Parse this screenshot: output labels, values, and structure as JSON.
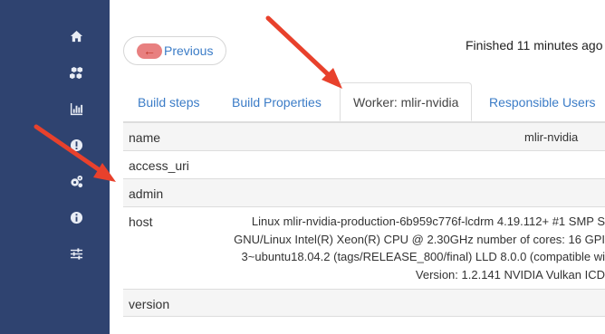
{
  "sidebar": {
    "icons": [
      "home-icon",
      "cubes-icon",
      "bar-chart-icon",
      "exclamation-icon",
      "cogs-icon",
      "info-icon",
      "sliders-icon"
    ]
  },
  "header": {
    "previous_label": "Previous",
    "finished_text": "Finished 11 minutes ago"
  },
  "tabs": [
    {
      "label": "Build steps"
    },
    {
      "label": "Build Properties"
    },
    {
      "label": "Worker: mlir-nvidia"
    },
    {
      "label": "Responsible Users"
    }
  ],
  "table": {
    "rows": [
      {
        "key": "name",
        "value": "mlir-nvidia"
      },
      {
        "key": "access_uri",
        "value": ""
      },
      {
        "key": "admin",
        "value": ""
      },
      {
        "key": "host",
        "lines": [
          "Linux mlir-nvidia-production-6b959c776f-lcdrm 4.19.112+ #1 SMP S",
          "GNU/Linux Intel(R) Xeon(R) CPU @ 2.30GHz number of cores: 16 GPI",
          "3~ubuntu18.04.2 (tags/RELEASE_800/final) LLD 8.0.0 (compatible wi",
          "Version: 1.2.141 NVIDIA Vulkan ICD"
        ]
      },
      {
        "key": "version",
        "value": ""
      }
    ]
  },
  "colors": {
    "sidebar": "#2f4370",
    "link": "#3b7cc7",
    "arrow": "#e8412c"
  }
}
